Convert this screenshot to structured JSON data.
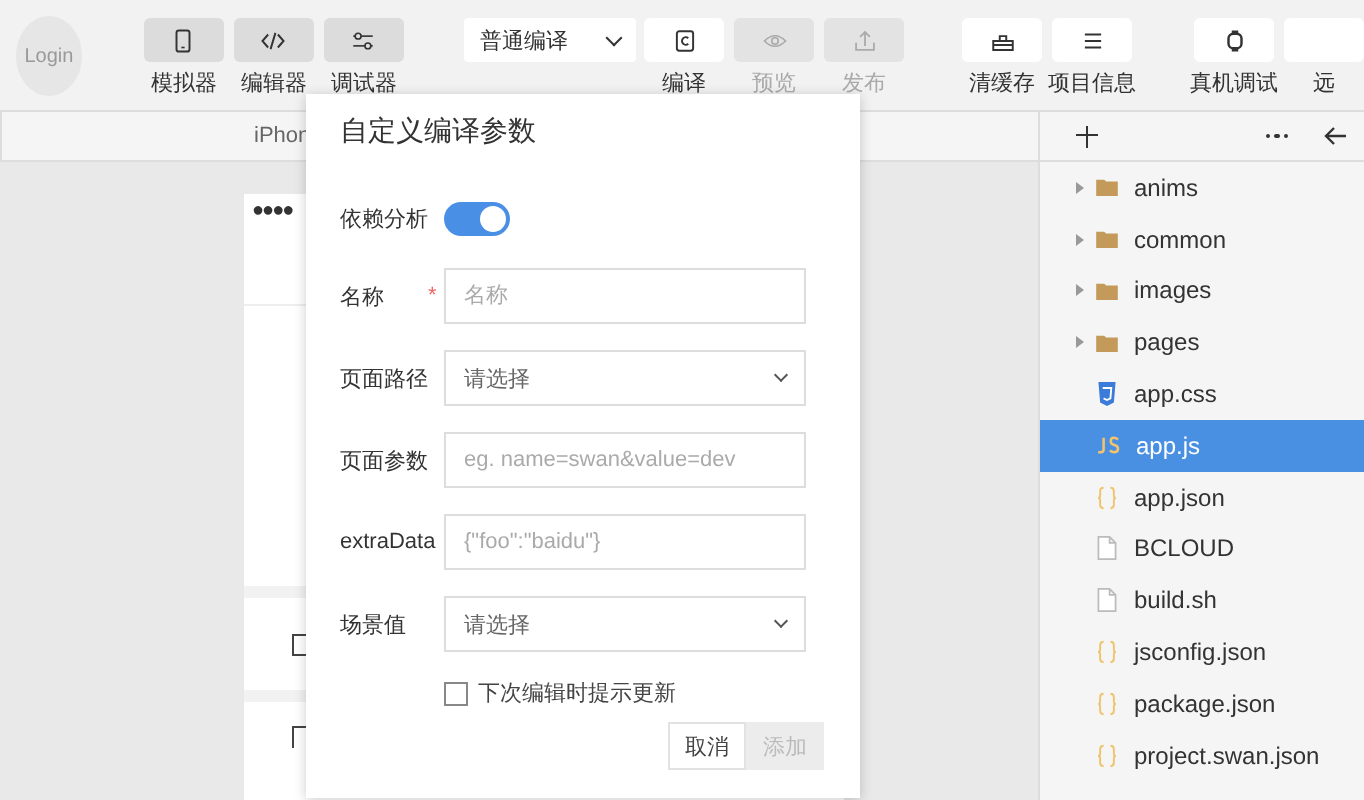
{
  "toolbar": {
    "login": "Login",
    "view_buttons": [
      {
        "label": "模拟器",
        "kind": "phone",
        "selected": true
      },
      {
        "label": "编辑器",
        "kind": "code",
        "selected": true
      },
      {
        "label": "调试器",
        "kind": "sliders",
        "selected": true
      }
    ],
    "compile_mode": "普通编译",
    "actions": [
      {
        "label": "编译",
        "kind": "compile",
        "disabled": false
      },
      {
        "label": "预览",
        "kind": "eye",
        "disabled": true
      },
      {
        "label": "发布",
        "kind": "upload",
        "disabled": true
      }
    ],
    "tools": [
      {
        "label": "清缓存",
        "kind": "broom"
      },
      {
        "label": "项目信息",
        "kind": "menu"
      }
    ],
    "device_tools": [
      {
        "label": "真机调试",
        "kind": "watch"
      },
      {
        "label": "远",
        "kind": "blank"
      }
    ]
  },
  "simulator": {
    "device": "iPhon",
    "signal": "●●●●"
  },
  "dialog": {
    "title": "自定义编译参数",
    "fields": [
      {
        "kind": "switch",
        "label": "依赖分析",
        "on": true
      },
      {
        "kind": "input",
        "label": "名称",
        "required_mark": "*",
        "placeholder": "名称"
      },
      {
        "kind": "select",
        "label": "页面路径",
        "placeholder": "请选择"
      },
      {
        "kind": "input",
        "label": "页面参数",
        "placeholder": "eg. name=swan&value=dev"
      },
      {
        "kind": "input",
        "label": "extraData",
        "placeholder": "{\"foo\":\"baidu\"}"
      },
      {
        "kind": "select",
        "label": "场景值",
        "placeholder": "请选择"
      }
    ],
    "checkbox": {
      "label": "下次编辑时提示更新",
      "checked": false
    },
    "buttons": [
      {
        "label": "取消",
        "disabled": false
      },
      {
        "label": "添加",
        "disabled": true
      }
    ]
  },
  "file_tree": {
    "items": [
      {
        "name": "anims",
        "kind": "folder",
        "expanded": false,
        "selected": false
      },
      {
        "name": "common",
        "kind": "folder",
        "expanded": false,
        "selected": false
      },
      {
        "name": "images",
        "kind": "folder",
        "expanded": false,
        "selected": false
      },
      {
        "name": "pages",
        "kind": "folder",
        "expanded": false,
        "selected": false
      },
      {
        "name": "app.css",
        "kind": "css",
        "selected": false
      },
      {
        "name": "app.js",
        "kind": "js",
        "selected": true
      },
      {
        "name": "app.json",
        "kind": "json",
        "selected": false
      },
      {
        "name": "BCLOUD",
        "kind": "file",
        "selected": false
      },
      {
        "name": "build.sh",
        "kind": "file",
        "selected": false
      },
      {
        "name": "jsconfig.json",
        "kind": "json",
        "selected": false
      },
      {
        "name": "package.json",
        "kind": "json",
        "selected": false
      },
      {
        "name": "project.swan.json",
        "kind": "json",
        "selected": false
      }
    ]
  }
}
